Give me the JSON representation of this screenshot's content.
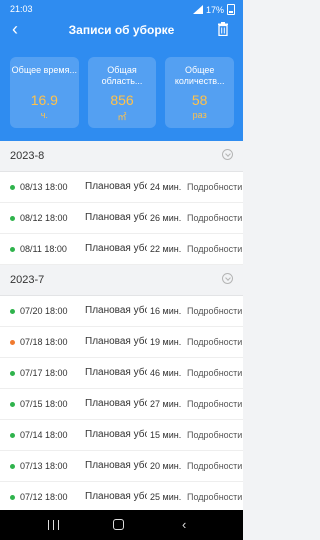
{
  "status_bar": {
    "time": "21:03",
    "battery": "17%"
  },
  "nav": {
    "back_glyph": "‹",
    "title": "Записи об уборке"
  },
  "summary": [
    {
      "label": "Общее время...",
      "value": "16.9",
      "unit": "ч."
    },
    {
      "label": "Общая область...",
      "value": "856",
      "unit": "㎡"
    },
    {
      "label": "Общее количеств...",
      "value": "58",
      "unit": "раз"
    }
  ],
  "colors": {
    "accent": "#2f8cf0",
    "value": "#ffc24b",
    "dot_ok": "#2fb34c",
    "dot_warn": "#f07a2f"
  },
  "groups": [
    {
      "label": "2023-8",
      "rows": [
        {
          "date": "08/13 18:00",
          "type": "Плановая уборка",
          "duration": "24 мин.",
          "more": "Подробности",
          "status": "ok"
        },
        {
          "date": "08/12 18:00",
          "type": "Плановая уборка",
          "duration": "26 мин.",
          "more": "Подробности",
          "status": "ok"
        },
        {
          "date": "08/11 18:00",
          "type": "Плановая уборка",
          "duration": "22 мин.",
          "more": "Подробности",
          "status": "ok"
        }
      ]
    },
    {
      "label": "2023-7",
      "rows": [
        {
          "date": "07/20 18:00",
          "type": "Плановая уборка",
          "duration": "16 мин.",
          "more": "Подробности",
          "status": "ok"
        },
        {
          "date": "07/18 18:00",
          "type": "Плановая уборка",
          "duration": "19 мин.",
          "more": "Подробности",
          "status": "warn"
        },
        {
          "date": "07/17 18:00",
          "type": "Плановая уборка",
          "duration": "46 мин.",
          "more": "Подробности",
          "status": "ok"
        },
        {
          "date": "07/15 18:00",
          "type": "Плановая уборка",
          "duration": "27 мин.",
          "more": "Подробности",
          "status": "ok"
        },
        {
          "date": "07/14 18:00",
          "type": "Плановая уборка",
          "duration": "15 мин.",
          "more": "Подробности",
          "status": "ok"
        },
        {
          "date": "07/13 18:00",
          "type": "Плановая уборка",
          "duration": "20 мин.",
          "more": "Подробности",
          "status": "ok"
        },
        {
          "date": "07/12 18:00",
          "type": "Плановая уборка",
          "duration": "25 мин.",
          "more": "Подробности",
          "status": "ok"
        }
      ]
    }
  ]
}
